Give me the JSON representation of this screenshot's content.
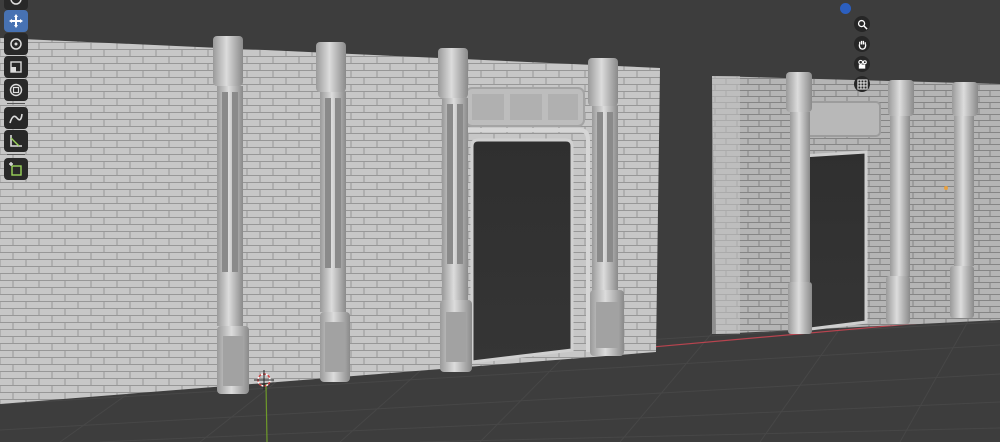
{
  "colors": {
    "accent": "#4772b3",
    "viewport_bg": "#3d3d3d",
    "x_axis": "#b8444f",
    "y_axis": "#6e9a2a",
    "z_gizmo": "#2c5fbf",
    "origin": "#e8a040"
  },
  "toolshelf": {
    "tools": [
      {
        "name": "select-tool",
        "icon": "select-box-icon",
        "active": false
      },
      {
        "name": "move-tool",
        "icon": "move-icon",
        "active": true
      },
      {
        "name": "rotate-tool",
        "icon": "rotate-icon",
        "active": false
      },
      {
        "name": "scale-tool",
        "icon": "scale-icon",
        "active": false
      },
      {
        "name": "transform-tool",
        "icon": "transform-icon",
        "active": false
      },
      {
        "name": "annotate-tool",
        "icon": "annotate-icon",
        "active": false
      },
      {
        "name": "measure-tool",
        "icon": "measure-icon",
        "active": false
      },
      {
        "name": "add-cube-tool",
        "icon": "add-cube-icon",
        "active": false
      }
    ]
  },
  "navigation": {
    "buttons": [
      "zoom-icon",
      "hand-pan-icon",
      "camera-icon",
      "ortho-grid-icon"
    ]
  }
}
